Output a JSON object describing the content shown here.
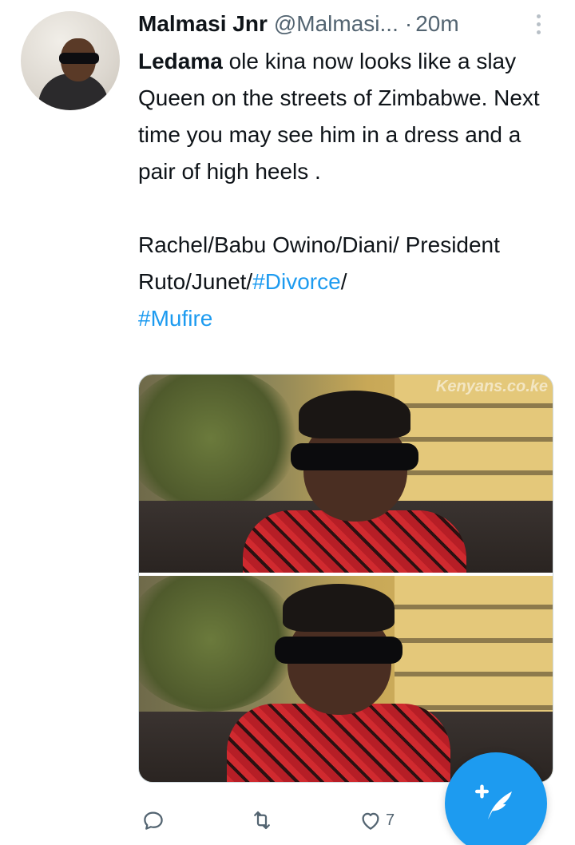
{
  "author": {
    "display_name": "Malmasi  Jnr",
    "handle": "@Malmasi...",
    "separator": "·",
    "time": "20m"
  },
  "tweet": {
    "line1_bold": "Ledama",
    "line1_rest": " ole kina now looks like a slay Queen on the streets of Zimbabwe. Next time you may see him in a dress and a pair of high heels .",
    "tags_plain": "Rachel/Babu Owino/Diani/ President Ruto/Junet/",
    "hashtag_1": "#Divorce",
    "slash": "/",
    "hashtag_2": "#Mufire"
  },
  "media": {
    "watermark": "Kenyans.co.ke"
  },
  "actions": {
    "reply_icon": "reply-icon",
    "retweet_icon": "retweet-icon",
    "like_icon": "heart-icon",
    "like_count": "7"
  },
  "fab": {
    "icon": "compose-tweet-icon"
  },
  "colors": {
    "accent": "#1d9bf0",
    "text": "#0f1419",
    "muted": "#536471"
  }
}
